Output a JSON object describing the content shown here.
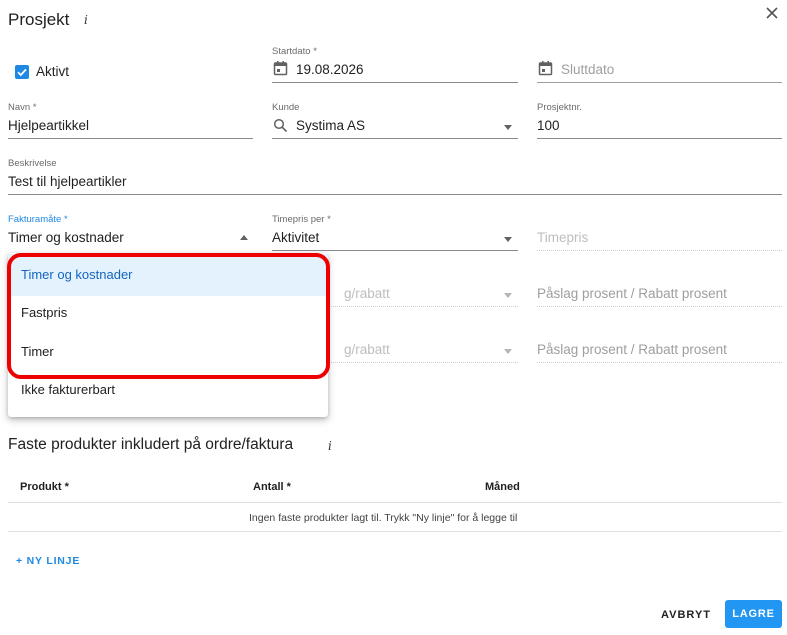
{
  "dialog": {
    "title": "Prosjekt",
    "info_glyph": "i"
  },
  "fields": {
    "active": {
      "label": "Aktivt",
      "checked": true
    },
    "start_date": {
      "label": "Startdato *",
      "value": "19.08.2026"
    },
    "end_date": {
      "placeholder": "Sluttdato"
    },
    "name": {
      "label": "Navn *",
      "value": "Hjelpeartikkel"
    },
    "customer": {
      "label": "Kunde",
      "value": "Systima AS"
    },
    "project_no": {
      "label": "Prosjektnr.",
      "value": "100"
    },
    "description": {
      "label": "Beskrivelse",
      "value": "Test til hjelpeartikler"
    },
    "billing_method": {
      "label": "Fakturamåte *",
      "value": "Timer og kostnader"
    },
    "hourly_rate_per": {
      "label": "Timepris per *",
      "value": "Aktivitet"
    },
    "hourly_rate": {
      "placeholder": "Timepris"
    },
    "markup_row1": {
      "select_text": "g/rabatt",
      "percent_placeholder": "Påslag prosent / Rabatt prosent"
    },
    "markup_row2": {
      "select_text": "g/rabatt",
      "percent_placeholder": "Påslag prosent / Rabatt prosent"
    }
  },
  "billing_menu": {
    "options": [
      "Timer og kostnader",
      "Fastpris",
      "Timer",
      "Ikke fakturerbart"
    ],
    "selected_index": 0
  },
  "products": {
    "title": "Faste produkter inkludert på ordre/faktura",
    "columns": [
      "Produkt *",
      "Antall *",
      "Måned"
    ],
    "empty_text": "Ingen faste produkter lagt til. Trykk \"Ny linje\" for å legge til",
    "add_line": "+ NY LINJE"
  },
  "footer": {
    "cancel": "AVBRYT",
    "save": "LAGRE"
  },
  "colors": {
    "accent": "#2196f3",
    "highlight": "#ee0000",
    "selected_bg": "#e3f2fd"
  }
}
